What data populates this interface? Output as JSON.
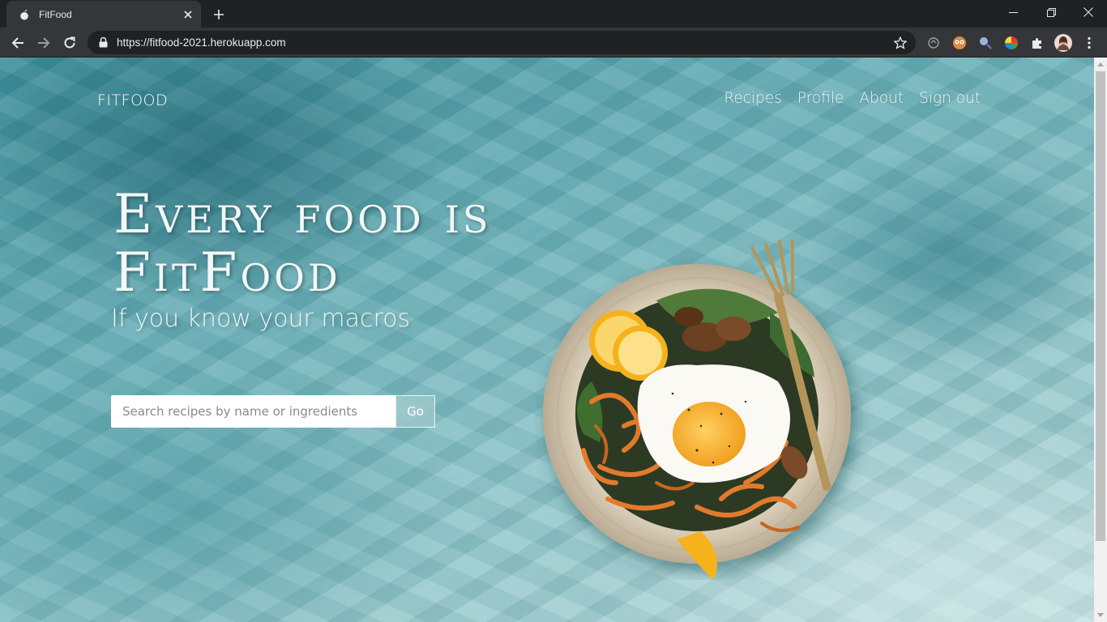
{
  "browser": {
    "tab": {
      "title": "FitFood",
      "favicon": "apple-icon"
    },
    "window_controls": [
      "minimize-icon",
      "restore-icon",
      "close-icon"
    ],
    "address": {
      "url": "https://fitfood-2021.herokuapp.com"
    },
    "extensions": [
      "sync-icon",
      "eyes-extension-icon",
      "magnifier-extension-icon",
      "color-wheel-extension-icon",
      "puzzle-icon",
      "avatar",
      "kebab-menu-icon"
    ]
  },
  "site": {
    "brand": "FITFOOD",
    "nav": [
      {
        "label": "Recipes"
      },
      {
        "label": "Profile"
      },
      {
        "label": "About"
      },
      {
        "label": "Sign out"
      }
    ]
  },
  "hero": {
    "title": "Every food is FitFood",
    "subtitle": "If you know your macros",
    "search": {
      "placeholder": "Search recipes by name or ingredients",
      "value": "",
      "button_label": "Go"
    }
  },
  "colors": {
    "chrome_dark": "#202124",
    "chrome_tab": "#35363a",
    "accent_teal": "#6bb0b8"
  }
}
